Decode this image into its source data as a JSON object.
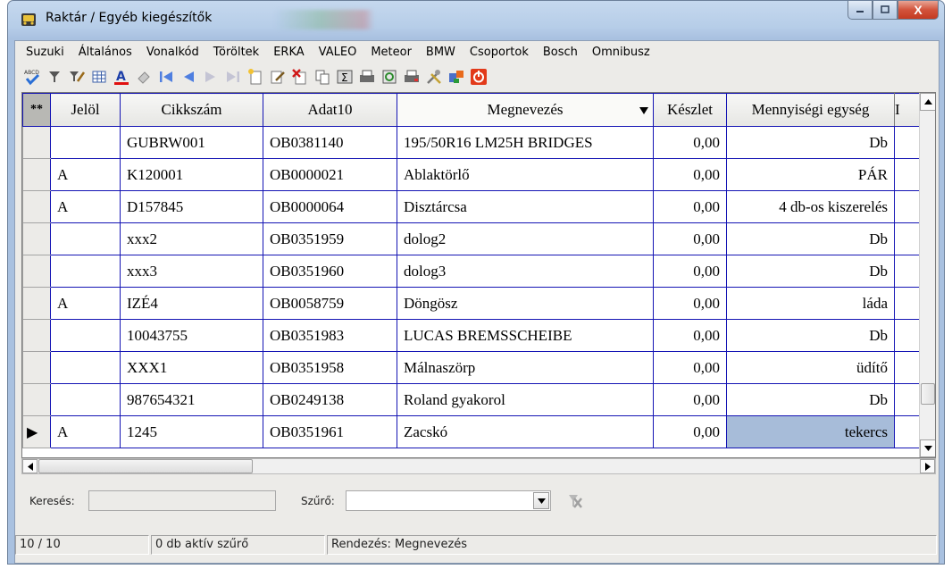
{
  "window": {
    "title": "Raktár / Egyéb kiegészítők",
    "close_label": "X"
  },
  "menu": [
    "Suzuki",
    "Általános",
    "Vonalkód",
    "Töröltek",
    "ERKA",
    "VALEO",
    "Meteor",
    "BMW",
    "Csoportok",
    "Bosch",
    "Omnibusz"
  ],
  "toolbar_icons": [
    "spell-check-icon",
    "filter-icon",
    "filter-edit-icon",
    "grid-icon",
    "font-color-icon",
    "eraser-icon",
    "first-record-icon",
    "prev-record-icon",
    "next-record-icon",
    "last-record-icon",
    "new-record-icon",
    "edit-record-icon",
    "delete-record-icon",
    "copy-icon",
    "sum-icon",
    "print-icon",
    "refresh-icon",
    "print-preview-icon",
    "tools-icon",
    "export-icon",
    "stop-icon"
  ],
  "grid": {
    "columns": [
      "**",
      "Jelöl",
      "Cikkszám",
      "Adat10",
      "Megnevezés",
      "Készlet",
      "Mennyiségi egység",
      "I"
    ],
    "rows": [
      {
        "ind": "",
        "jelol": "",
        "cikkszam": "GUBRW001",
        "adat10": "OB0381140",
        "megnevezes": "195/50R16 LM25H BRIDGES",
        "keszlet": "0,00",
        "egyseg": "Db"
      },
      {
        "ind": "",
        "jelol": "A",
        "cikkszam": "K120001",
        "adat10": "OB0000021",
        "megnevezes": "Ablaktörlő",
        "keszlet": "0,00",
        "egyseg": "PÁR"
      },
      {
        "ind": "",
        "jelol": "A",
        "cikkszam": "D157845",
        "adat10": "OB0000064",
        "megnevezes": "Disztárcsa",
        "keszlet": "0,00",
        "egyseg": "4 db-os kiszerelés"
      },
      {
        "ind": "",
        "jelol": "",
        "cikkszam": "xxx2",
        "adat10": "OB0351959",
        "megnevezes": "dolog2",
        "keszlet": "0,00",
        "egyseg": "Db"
      },
      {
        "ind": "",
        "jelol": "",
        "cikkszam": "xxx3",
        "adat10": "OB0351960",
        "megnevezes": "dolog3",
        "keszlet": "0,00",
        "egyseg": "Db"
      },
      {
        "ind": "",
        "jelol": "A",
        "cikkszam": "IZÉ4",
        "adat10": "OB0058759",
        "megnevezes": "Döngösz",
        "keszlet": "0,00",
        "egyseg": "láda"
      },
      {
        "ind": "",
        "jelol": "",
        "cikkszam": "10043755",
        "adat10": "OB0351983",
        "megnevezes": "LUCAS BREMSSCHEIBE",
        "keszlet": "0,00",
        "egyseg": "Db"
      },
      {
        "ind": "",
        "jelol": "",
        "cikkszam": "XXX1",
        "adat10": "OB0351958",
        "megnevezes": "Málnaszörp",
        "keszlet": "0,00",
        "egyseg": "üdítő"
      },
      {
        "ind": "",
        "jelol": "",
        "cikkszam": "987654321",
        "adat10": "OB0249138",
        "megnevezes": "Roland gyakorol",
        "keszlet": "0,00",
        "egyseg": "Db"
      },
      {
        "ind": "▶",
        "jelol": "A",
        "cikkszam": "1245",
        "adat10": "OB0351961",
        "megnevezes": "Zacskó",
        "keszlet": "0,00",
        "egyseg": "tekercs"
      }
    ]
  },
  "search": {
    "label": "Keresés:",
    "value": "",
    "filter_label": "Szűrő:",
    "filter_value": ""
  },
  "status": {
    "count": "10 / 10",
    "filters": "0 db aktív szűrő",
    "sort": "Rendezés: Megnevezés"
  },
  "colors": {
    "grid_line": "#1414b4",
    "selected_cell": "#a7bcd9",
    "current_row_marker": "#0000ff"
  }
}
